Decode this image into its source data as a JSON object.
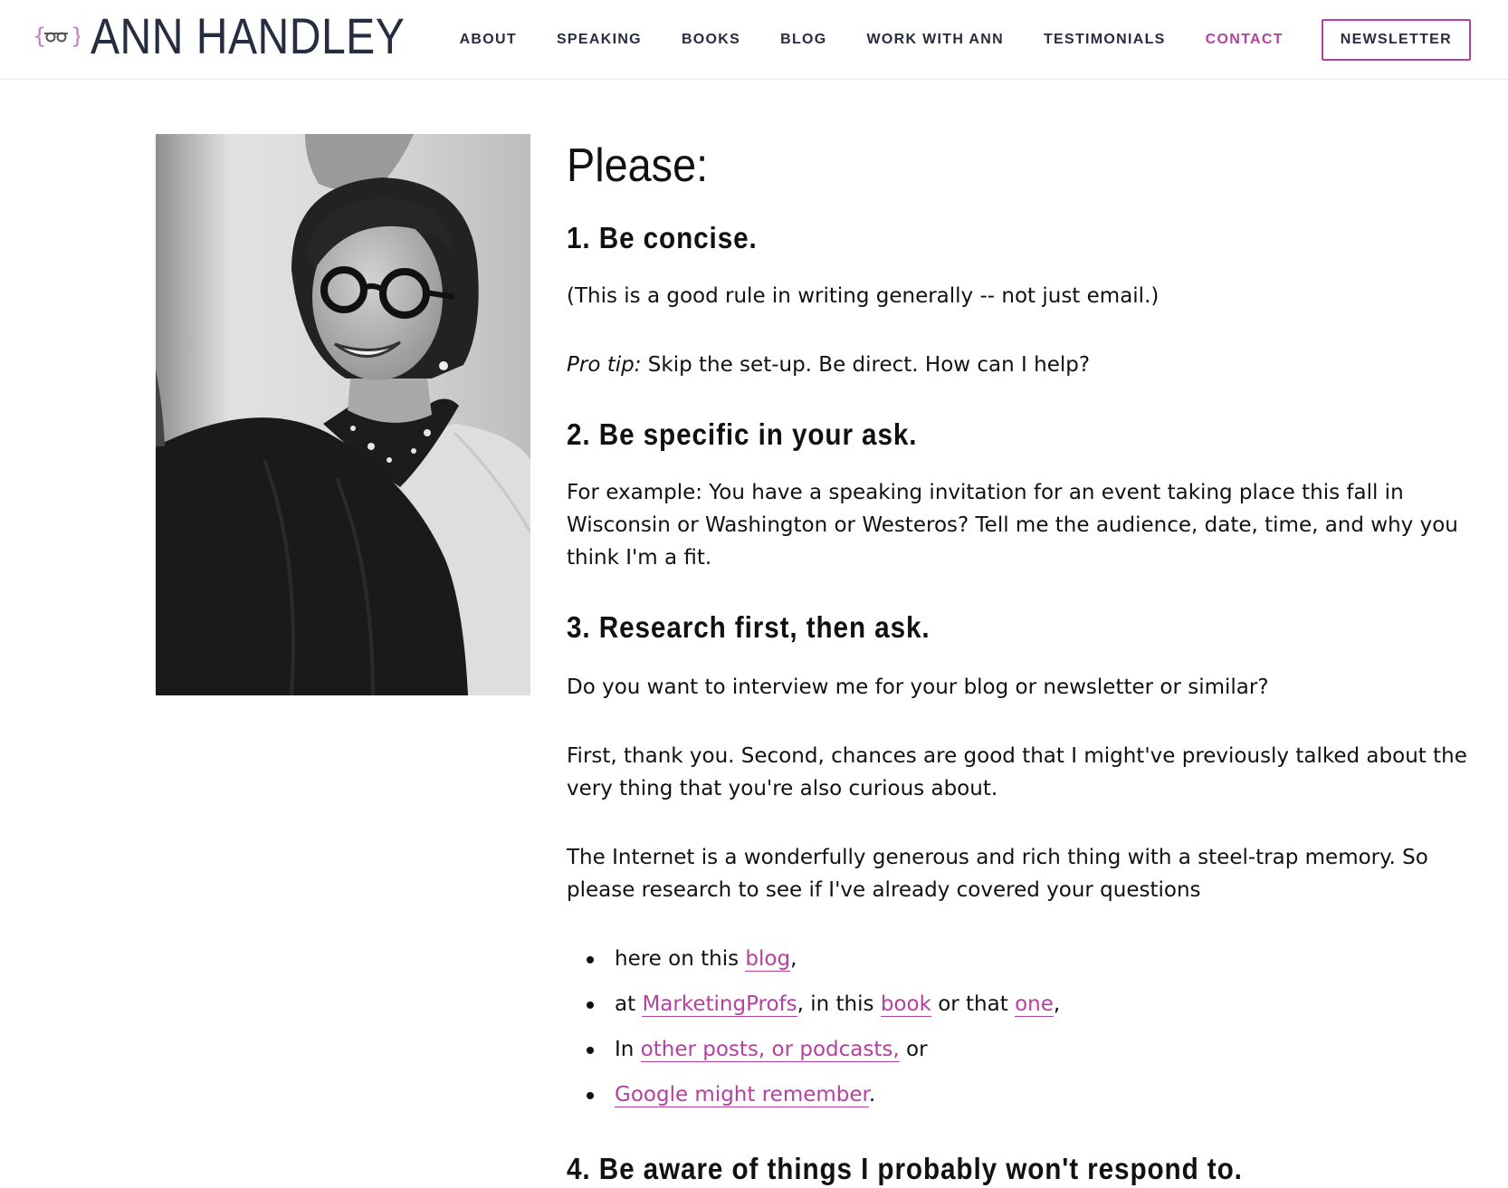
{
  "header": {
    "brand_name": "ANN HANDLEY",
    "brand_icon": "glasses-braces-icon",
    "accent_color": "#b5419e",
    "text_color": "#262d40",
    "nav": [
      {
        "label": "ABOUT"
      },
      {
        "label": "SPEAKING"
      },
      {
        "label": "BOOKS"
      },
      {
        "label": "BLOG"
      },
      {
        "label": "WORK WITH ANN"
      },
      {
        "label": "TESTIMONIALS"
      },
      {
        "label": "CONTACT",
        "current": true
      },
      {
        "label": "NEWSLETTER",
        "style": "outlined-button"
      }
    ]
  },
  "content": {
    "heading": "Please:",
    "section1": {
      "title": "1. Be concise.",
      "p1": "(This is a good rule in writing generally -- not just email.)",
      "tip_label": "Pro tip:",
      "tip_text": " Skip the set-up. Be direct. How can I help?"
    },
    "section2": {
      "title": "2. Be specific in your ask.",
      "p1": "For example: You have a speaking invitation for an event taking place this fall in Wisconsin or Washington or Westeros? Tell me the audience, date, time, and why you think I'm a fit."
    },
    "section3": {
      "title": "3. Research first, then ask.",
      "p1": "Do you want to interview me for your blog or newsletter or similar?",
      "p2": "First, thank you. Second, chances are good that I might've previously talked about the very thing that you're also curious about.",
      "p3": "The Internet is a wonderfully generous and rich thing with a steel-trap memory. So please research to see if I've already covered  your questions",
      "list": {
        "item1": {
          "before": "here on this ",
          "link": "blog",
          "after": ","
        },
        "item2": {
          "before": "at ",
          "link1": "MarketingProfs",
          "mid1": ", in this ",
          "link2": "book",
          "mid2": " or that ",
          "link3": "one",
          "after": ","
        },
        "item3": {
          "before": "In ",
          "link": "other posts, or podcasts,",
          "after": " or"
        },
        "item4": {
          "link": "Google might remember",
          "after": "."
        }
      }
    },
    "section4": {
      "title": "4. Be aware of things I probably won't respond to."
    }
  }
}
